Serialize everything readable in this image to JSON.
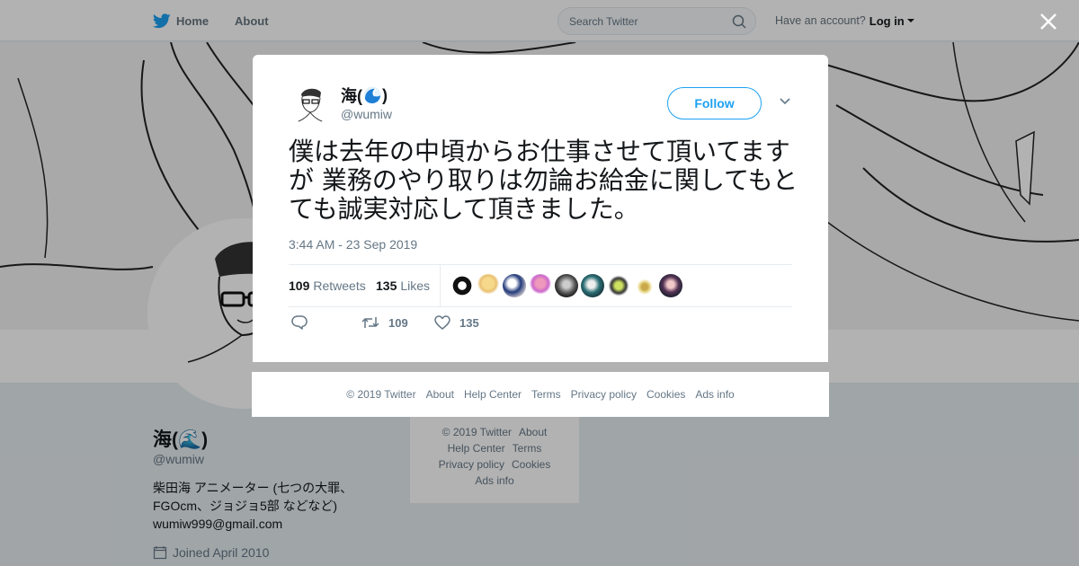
{
  "nav": {
    "home_label": "Home",
    "about_label": "About",
    "search_placeholder": "Search Twitter",
    "have_account": "Have an account?",
    "login_label": "Log in"
  },
  "profile": {
    "name": "海(🌊)",
    "handle": "@wumiw",
    "bio_line1": "柴田海 アニメーター (七つの大罪、",
    "bio_line2": "FGOcm、ジョジョ5部 などなど)",
    "email": "wumiw999@gmail.com",
    "joined": "Joined April 2010"
  },
  "side_footer": {
    "copyright": "© 2019 Twitter",
    "about": "About",
    "help": "Help Center",
    "terms": "Terms",
    "privacy": "Privacy policy",
    "cookies": "Cookies",
    "ads": "Ads info"
  },
  "tweet": {
    "author_name": "海(",
    "author_name_end": ")",
    "author_handle": "@wumiw",
    "follow_label": "Follow",
    "text": "僕は去年の中頃からお仕事させて頂いてますが 業務のやり取りは勿論お給金に関してもとても誠実対応して頂きました。",
    "timestamp": "3:44 AM - 23 Sep 2019",
    "retweets_count": "109",
    "retweets_label": "Retweets",
    "likes_count": "135",
    "likes_label": "Likes",
    "action_retweet_count": "109",
    "action_like_count": "135"
  },
  "modal_footer": {
    "copyright": "© 2019 Twitter",
    "about": "About",
    "help": "Help Center",
    "terms": "Terms",
    "privacy": "Privacy policy",
    "cookies": "Cookies",
    "ads": "Ads info"
  },
  "colors": {
    "accent": "#1da1f2",
    "text_secondary": "#657786",
    "overlay": "rgba(0,0,0,0.30)"
  },
  "icons": [
    "twitter-bird-icon",
    "search-icon",
    "close-icon",
    "chevron-down-icon",
    "reply-icon",
    "retweet-icon",
    "heart-icon",
    "calendar-icon",
    "wave-emoji-icon"
  ]
}
